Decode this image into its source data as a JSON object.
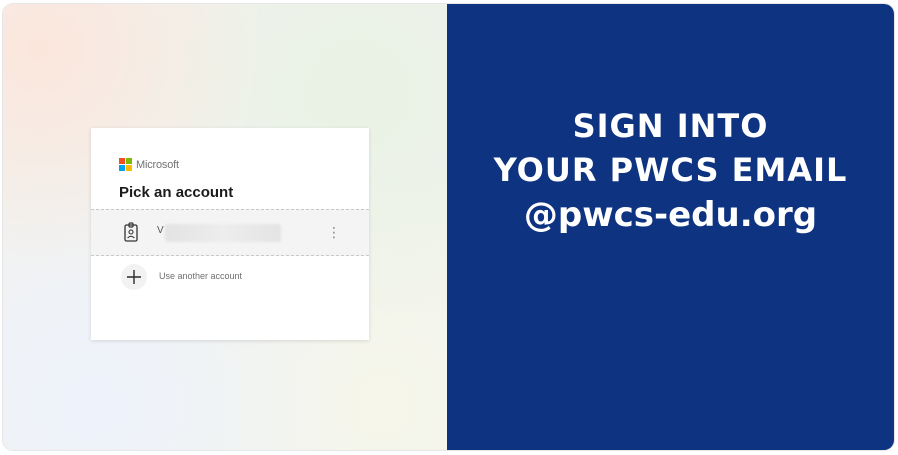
{
  "dialog": {
    "brand": "Microsoft",
    "title": "Pick an account",
    "account_initial": "V",
    "more_glyph": "⋮",
    "use_another_label": "Use another account"
  },
  "headline": {
    "line1": "SIGN INTO",
    "line2": "YOUR PWCS EMAIL",
    "line3": "@pwcs-edu.org"
  },
  "colors": {
    "panel_blue": "#0d3381",
    "ms_red": "#f25022",
    "ms_green": "#7fba00",
    "ms_blue": "#00a4ef",
    "ms_yellow": "#ffb900"
  },
  "icons": {
    "logo": "microsoft-logo-icon",
    "account": "id-badge-icon",
    "more": "more-vertical-icon",
    "add": "plus-icon"
  }
}
